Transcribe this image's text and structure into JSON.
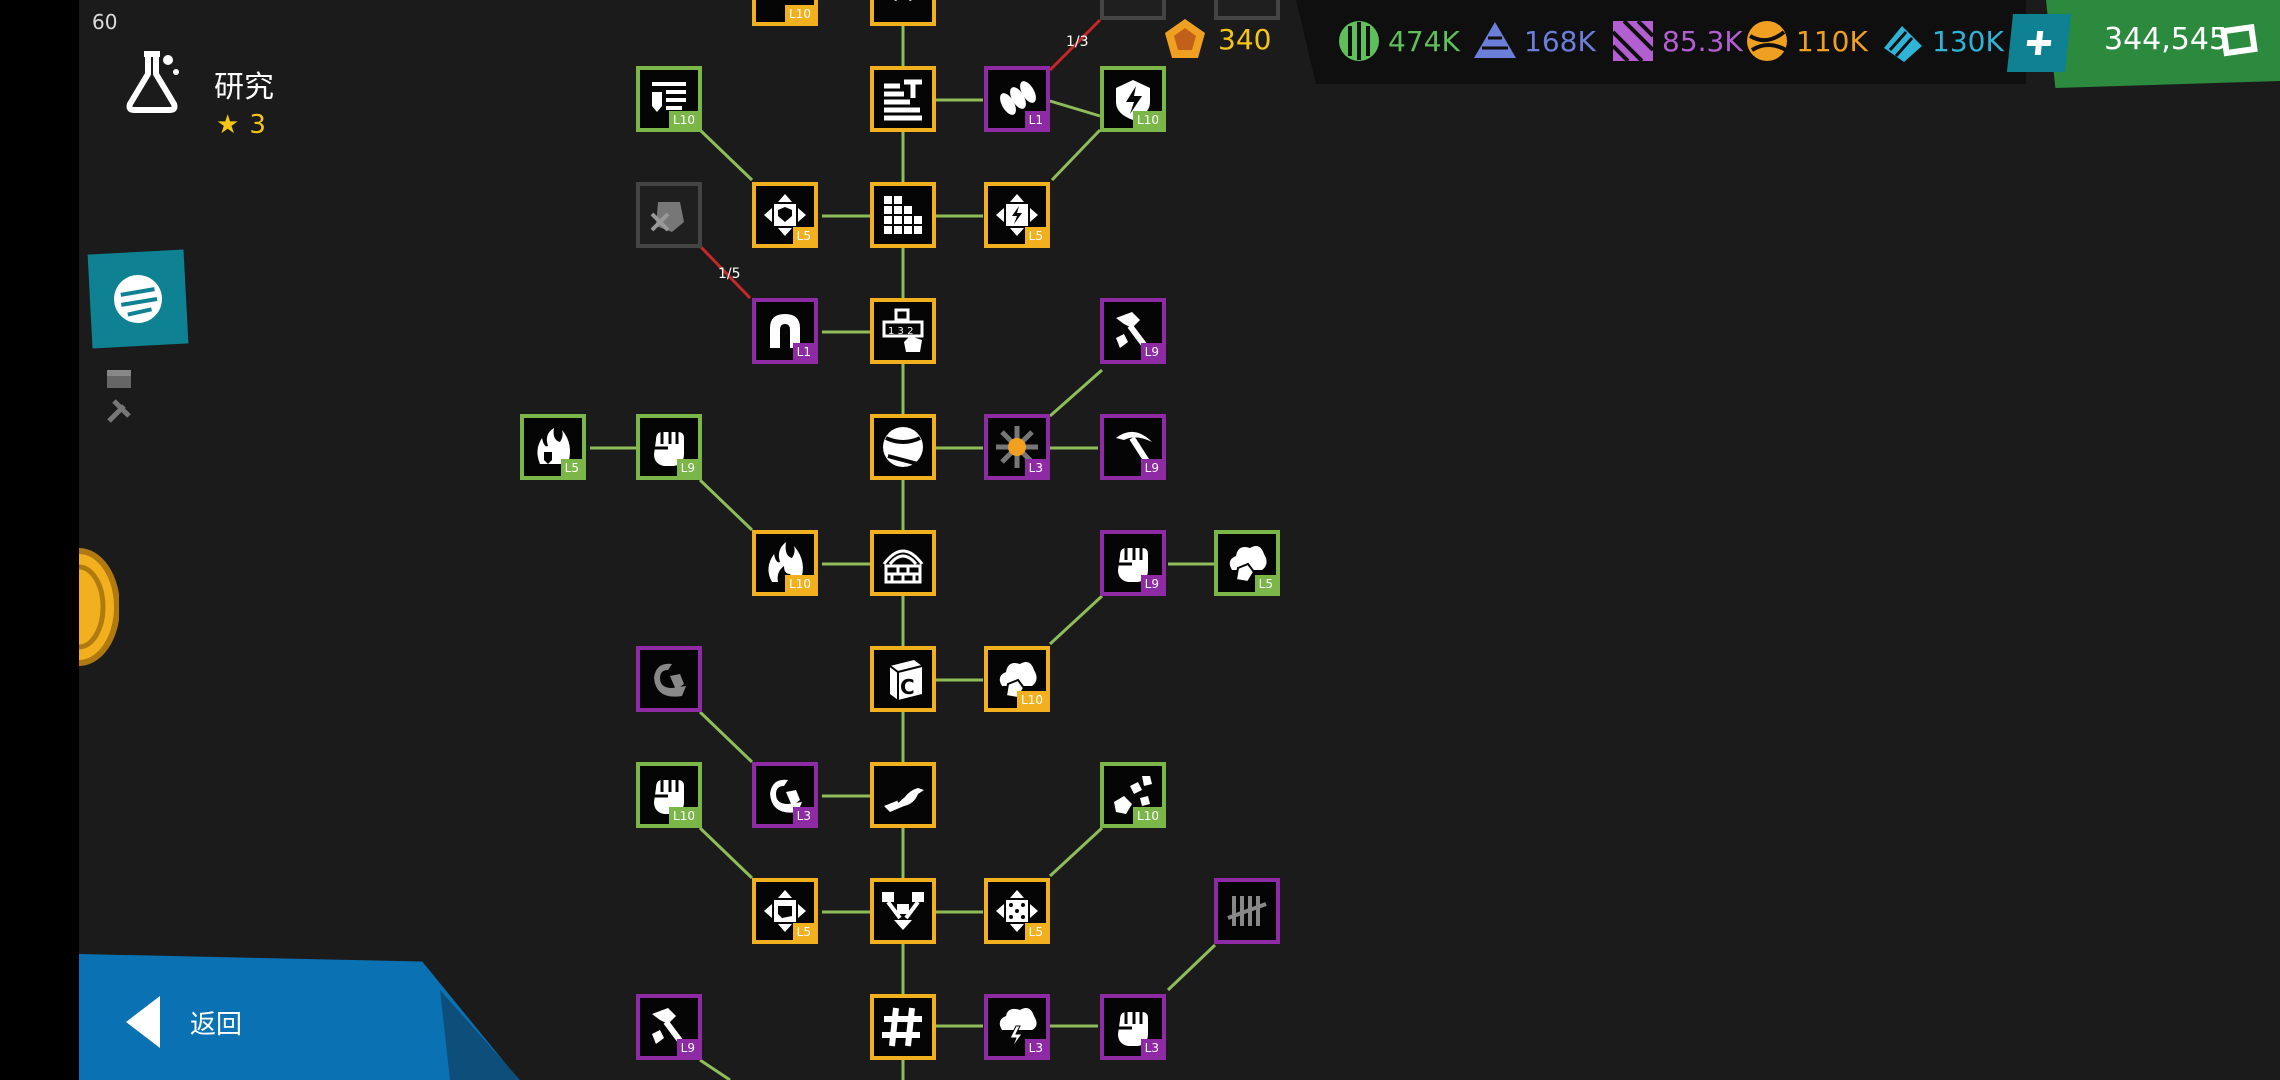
{
  "fps": "60",
  "header": {
    "title": "研究",
    "stars": "3"
  },
  "resources": {
    "gem": "340",
    "items": [
      {
        "name": "green-resource",
        "value": "474K",
        "color": "#5fbf5a"
      },
      {
        "name": "blue-resource",
        "value": "168K",
        "color": "#6c7fd8"
      },
      {
        "name": "purple-resource",
        "value": "85.3K",
        "color": "#b35fd1"
      },
      {
        "name": "orange-resource",
        "value": "110K",
        "color": "#f0a020"
      },
      {
        "name": "cyan-resource",
        "value": "130K",
        "color": "#2fb3d6"
      }
    ],
    "money": "344,545"
  },
  "back_label": "返回",
  "progress_labels": [
    "1/3",
    "1/5"
  ],
  "nodes": [
    {
      "id": "n0",
      "color": "green",
      "level": "L10",
      "icon": "list-shield-icon"
    },
    {
      "id": "n1",
      "color": "yellow",
      "level": "",
      "icon": "stats-icon"
    },
    {
      "id": "n2",
      "color": "purple",
      "level": "L1",
      "icon": "bullets-icon"
    },
    {
      "id": "n3",
      "color": "green",
      "level": "L10",
      "icon": "energy-shield-icon"
    },
    {
      "id": "n4",
      "color": "gray",
      "level": "",
      "icon": "crossed-fist-icon"
    },
    {
      "id": "n5",
      "color": "yellow",
      "level": "L5",
      "icon": "spread-shield-icon"
    },
    {
      "id": "n6",
      "color": "yellow",
      "level": "",
      "icon": "grid-icon"
    },
    {
      "id": "n7",
      "color": "yellow",
      "level": "L5",
      "icon": "spread-bolt-icon"
    },
    {
      "id": "n8",
      "color": "purple",
      "level": "L1",
      "icon": "magnet-icon"
    },
    {
      "id": "n9",
      "color": "yellow",
      "level": "",
      "icon": "blocks-icon"
    },
    {
      "id": "n10",
      "color": "purple",
      "level": "L9",
      "icon": "hammer-icon"
    },
    {
      "id": "n11",
      "color": "green",
      "level": "L5",
      "icon": "fire-shield-icon"
    },
    {
      "id": "n12",
      "color": "green",
      "level": "L9",
      "icon": "fist-icon"
    },
    {
      "id": "n13",
      "color": "yellow",
      "level": "",
      "icon": "ball-icon"
    },
    {
      "id": "n14",
      "color": "purple",
      "level": "L3",
      "icon": "burst-icon"
    },
    {
      "id": "n15",
      "color": "purple",
      "level": "L9",
      "icon": "pickaxe-icon"
    },
    {
      "id": "n16",
      "color": "yellow",
      "level": "L10",
      "icon": "fire-icon"
    },
    {
      "id": "n17",
      "color": "yellow",
      "level": "",
      "icon": "rainbow-wall-icon"
    },
    {
      "id": "n18",
      "color": "purple",
      "level": "L9",
      "icon": "fist-icon"
    },
    {
      "id": "n19",
      "color": "green",
      "level": "L5",
      "icon": "cloud-shield-icon"
    },
    {
      "id": "n20",
      "color": "yellow",
      "level": "",
      "icon": "cube-icon"
    },
    {
      "id": "n21",
      "color": "yellow",
      "level": "L10",
      "icon": "cloud-shield-icon"
    },
    {
      "id": "n22",
      "color": "purple",
      "level": "",
      "icon": "swirl-icon"
    },
    {
      "id": "n23",
      "color": "green",
      "level": "L10",
      "icon": "fist-icon"
    },
    {
      "id": "n24",
      "color": "purple",
      "level": "L3",
      "icon": "swirl-icon"
    },
    {
      "id": "n25",
      "color": "yellow",
      "level": "",
      "icon": "bird-icon"
    },
    {
      "id": "n26",
      "color": "green",
      "level": "L10",
      "icon": "scatter-icon"
    },
    {
      "id": "n27",
      "color": "yellow",
      "level": "L5",
      "icon": "spread-fist-icon"
    },
    {
      "id": "n28",
      "color": "yellow",
      "level": "",
      "icon": "merge-icon"
    },
    {
      "id": "n29",
      "color": "yellow",
      "level": "L5",
      "icon": "spread-dice-icon"
    },
    {
      "id": "n30",
      "color": "purple",
      "level": "",
      "icon": "tally-icon"
    },
    {
      "id": "n31",
      "color": "purple",
      "level": "L9",
      "icon": "hammer-icon"
    },
    {
      "id": "n32",
      "color": "yellow",
      "level": "",
      "icon": "hash-icon"
    },
    {
      "id": "n33",
      "color": "purple",
      "level": "L3",
      "icon": "storm-icon"
    },
    {
      "id": "n34",
      "color": "purple",
      "level": "L3",
      "icon": "fist-icon"
    },
    {
      "id": "t0",
      "color": "yellow",
      "level": "L10",
      "icon": "partial-icon"
    },
    {
      "id": "t1",
      "color": "yellow",
      "level": "",
      "icon": "partial-icon"
    },
    {
      "id": "t2",
      "color": "gray",
      "level": "",
      "icon": "partial-icon"
    },
    {
      "id": "t3",
      "color": "gray",
      "level": "",
      "icon": "partial-icon"
    }
  ]
}
